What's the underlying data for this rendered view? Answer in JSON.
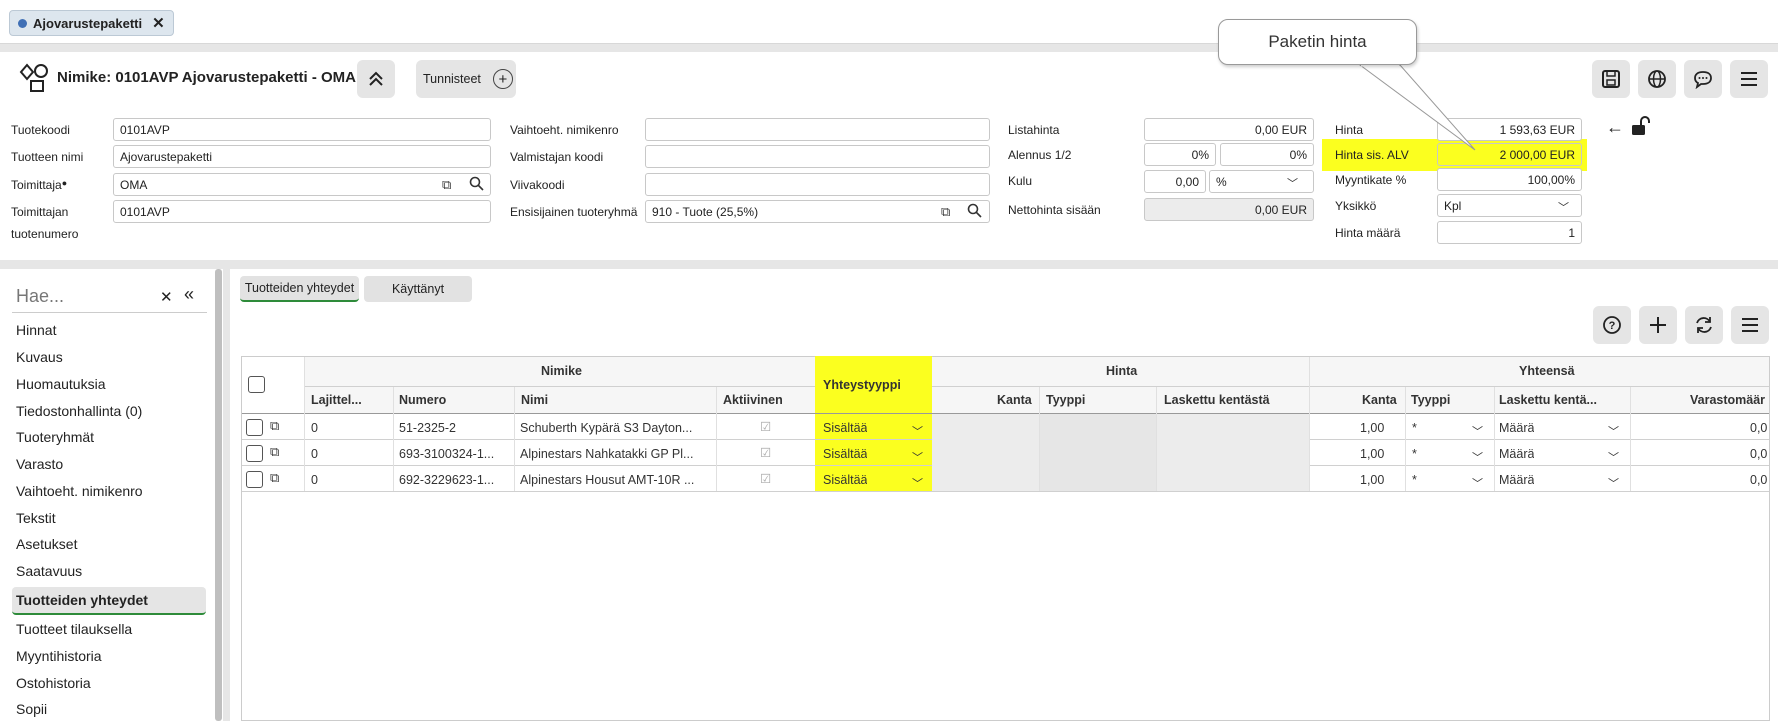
{
  "tab": {
    "label": "Ajovarustepaketti"
  },
  "header": {
    "title": "Nimike: 0101AVP Ajovarustepaketti - OMA",
    "tunnisteet_label": "Tunnisteet",
    "callout": "Paketin hinta"
  },
  "form": {
    "col1": [
      {
        "label": "Tuotekoodi",
        "value": "0101AVP"
      },
      {
        "label": "Tuotteen nimi",
        "value": "Ajovarustepaketti"
      },
      {
        "label": "Toimittaja",
        "value": "OMA"
      },
      {
        "label": "Toimittajan",
        "label2": "tuotenumero",
        "value": "0101AVP"
      }
    ],
    "col2": [
      {
        "label": "Vaihtoeht. nimikenro",
        "value": ""
      },
      {
        "label": "Valmistajan koodi",
        "value": ""
      },
      {
        "label": "Viivakoodi",
        "value": ""
      },
      {
        "label": "Ensisijainen tuoteryhmä",
        "value": "910 - Tuote (25,5%)"
      }
    ],
    "col3": {
      "listahinta_label": "Listahinta",
      "listahinta": "0,00  EUR",
      "alennus_label": "Alennus 1/2",
      "alennus1": "0%",
      "alennus2": "0%",
      "kulu_label": "Kulu",
      "kulu": "0,00",
      "kulu_unit": "%",
      "netto_label": "Nettohinta sisään",
      "netto": "0,00 EUR"
    },
    "col4": {
      "hinta_label": "Hinta",
      "hinta": "1 593,63 EUR",
      "alv_label": "Hinta sis. ALV",
      "alv": "2 000,00 EUR",
      "myyntikate_label": "Myyntikate %",
      "myyntikate": "100,00%",
      "yksikko_label": "Yksikkö",
      "yksikko": "Kpl",
      "maara_label": "Hinta määrä",
      "maara": "1"
    }
  },
  "sidebar": {
    "search_placeholder": "Hae...",
    "items": [
      "Hinnat",
      "Kuvaus",
      "Huomautuksia",
      "Tiedostonhallinta (0)",
      "Tuoteryhmät",
      "Varasto",
      "Vaihtoeht. nimikenro",
      "Tekstit",
      "Asetukset",
      "Saatavuus",
      "Tuotteiden yhteydet",
      "Tuotteet tilauksella",
      "Myyntihistoria",
      "Ostohistoria",
      "Sopii"
    ],
    "active": "Tuotteiden yhteydet"
  },
  "subtabs": [
    "Tuotteiden yhteydet",
    "Käyttänyt"
  ],
  "grid": {
    "group_headers": {
      "nimike": "Nimike",
      "yhteystyyppi": "Yhteystyyppi",
      "hinta": "Hinta",
      "yhteensa": "Yhteensä"
    },
    "columns": [
      "Lajittel...",
      "Numero",
      "Nimi",
      "Aktiivinen",
      "Kanta",
      "Tyyppi",
      "Laskettu kentästä",
      "Kanta",
      "Tyyppi",
      "Laskettu kentä...",
      "Varastomäär"
    ],
    "rows": [
      {
        "lajittelu": "0",
        "numero": "51-2325-2",
        "nimi": "Schuberth Kypärä S3 Dayton...",
        "yhteystyyppi": "Sisältää",
        "kanta": "1,00",
        "tyyppi": "*",
        "laskettu": "Määrä",
        "varasto": "0,0"
      },
      {
        "lajittelu": "0",
        "numero": "693-3100324-1...",
        "nimi": "Alpinestars Nahkatakki GP Pl...",
        "yhteystyyppi": "Sisältää",
        "kanta": "1,00",
        "tyyppi": "*",
        "laskettu": "Määrä",
        "varasto": "0,0"
      },
      {
        "lajittelu": "0",
        "numero": "692-3229623-1...",
        "nimi": "Alpinestars Housut AMT-10R ...",
        "yhteystyyppi": "Sisältää",
        "kanta": "1,00",
        "tyyppi": "*",
        "laskettu": "Määrä",
        "varasto": "0,0"
      }
    ]
  }
}
